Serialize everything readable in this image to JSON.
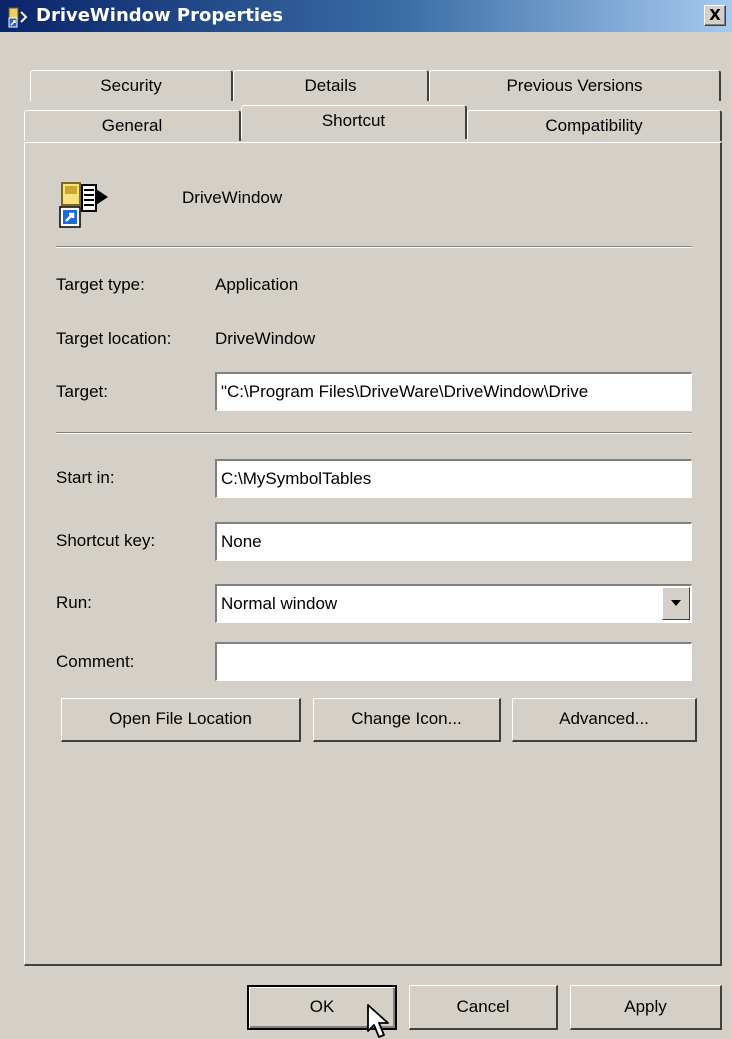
{
  "window": {
    "title": "DriveWindow Properties",
    "close_label": "X"
  },
  "tabs": {
    "back_row": [
      {
        "label": "Security"
      },
      {
        "label": "Details"
      },
      {
        "label": "Previous Versions"
      }
    ],
    "front_row": [
      {
        "label": "General"
      },
      {
        "label": "Shortcut"
      },
      {
        "label": "Compatibility"
      }
    ],
    "active": "Shortcut"
  },
  "shortcut": {
    "name": "DriveWindow",
    "icon": "application-shortcut-icon",
    "target_type_label": "Target type:",
    "target_type_value": "Application",
    "target_location_label": "Target location:",
    "target_location_value": "DriveWindow",
    "target_label": "Target:",
    "target_value": "\"C:\\Program Files\\DriveWare\\DriveWindow\\Drive",
    "start_in_label": "Start in:",
    "start_in_value": "C:\\MySymbolTables",
    "shortcut_key_label": "Shortcut key:",
    "shortcut_key_value": "None",
    "run_label": "Run:",
    "run_value": "Normal window",
    "comment_label": "Comment:",
    "comment_value": "",
    "open_file_location_label": "Open File Location",
    "change_icon_label": "Change Icon...",
    "advanced_label": "Advanced..."
  },
  "footer": {
    "ok_label": "OK",
    "cancel_label": "Cancel",
    "apply_label": "Apply"
  },
  "colors": {
    "titlebar_start": "#0a246a",
    "titlebar_end": "#a6caf0",
    "dialog_face": "#d4d0c8"
  }
}
